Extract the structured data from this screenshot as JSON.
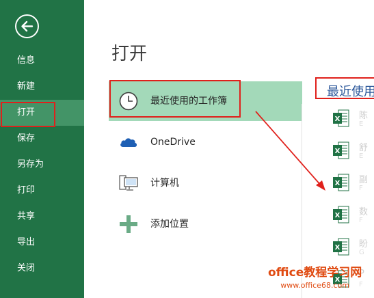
{
  "sidebar": {
    "back_icon": "back-arrow-circle-icon",
    "items": [
      {
        "label": "信息"
      },
      {
        "label": "新建"
      },
      {
        "label": "打开",
        "active": true
      },
      {
        "label": "保存"
      },
      {
        "label": "另存为"
      },
      {
        "label": "打印"
      },
      {
        "label": "共享"
      },
      {
        "label": "导出"
      },
      {
        "label": "关闭"
      }
    ]
  },
  "main": {
    "title": "打开",
    "places": [
      {
        "label": "最近使用的工作簿",
        "icon": "clock-icon",
        "selected": true
      },
      {
        "label": "OneDrive",
        "icon": "cloud-icon"
      },
      {
        "label": "计算机",
        "icon": "computer-icon"
      },
      {
        "label": "添加位置",
        "icon": "plus-icon"
      }
    ],
    "recent": {
      "title": "最近使用",
      "files": [
        {
          "name": "陈",
          "path": "E"
        },
        {
          "name": "舒",
          "path": "E"
        },
        {
          "name": "副",
          "path": "F"
        },
        {
          "name": "数",
          "path": "F"
        },
        {
          "name": "盼",
          "path": "G"
        },
        {
          "name": "P",
          "path": "F"
        }
      ]
    }
  },
  "watermark": {
    "line1": "office教程学习网",
    "line2": "www.office68.com"
  },
  "colors": {
    "sidebar_bg": "#217346",
    "selected_bg": "#a3d9b9",
    "highlight": "#e0201b",
    "excel_green": "#207245"
  }
}
